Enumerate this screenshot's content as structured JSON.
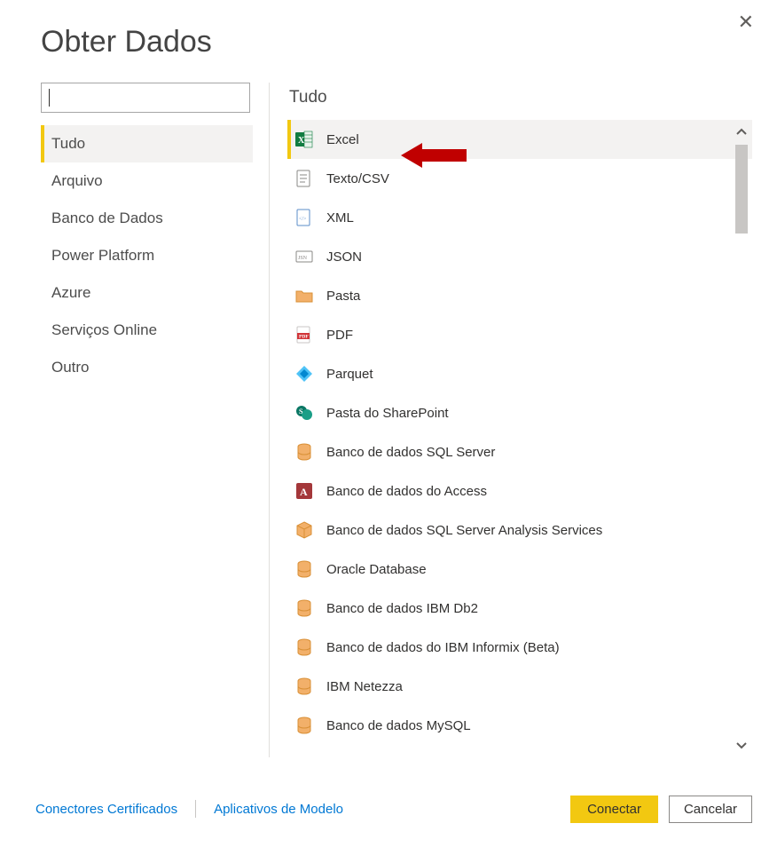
{
  "dialog": {
    "title": "Obter Dados",
    "close_icon": "✕"
  },
  "search": {
    "value": "",
    "placeholder": ""
  },
  "categories": [
    {
      "label": "Tudo",
      "selected": true
    },
    {
      "label": "Arquivo",
      "selected": false
    },
    {
      "label": "Banco de Dados",
      "selected": false
    },
    {
      "label": "Power Platform",
      "selected": false
    },
    {
      "label": "Azure",
      "selected": false
    },
    {
      "label": "Serviços Online",
      "selected": false
    },
    {
      "label": "Outro",
      "selected": false
    }
  ],
  "panel": {
    "header": "Tudo"
  },
  "connectors": [
    {
      "label": "Excel",
      "icon": "excel",
      "selected": true
    },
    {
      "label": "Texto/CSV",
      "icon": "text",
      "selected": false
    },
    {
      "label": "XML",
      "icon": "xml",
      "selected": false
    },
    {
      "label": "JSON",
      "icon": "json",
      "selected": false
    },
    {
      "label": "Pasta",
      "icon": "folder",
      "selected": false
    },
    {
      "label": "PDF",
      "icon": "pdf",
      "selected": false
    },
    {
      "label": "Parquet",
      "icon": "parquet",
      "selected": false
    },
    {
      "label": "Pasta do SharePoint",
      "icon": "sharepoint",
      "selected": false
    },
    {
      "label": "Banco de dados SQL Server",
      "icon": "db",
      "selected": false
    },
    {
      "label": "Banco de dados do Access",
      "icon": "access",
      "selected": false
    },
    {
      "label": "Banco de dados SQL Server Analysis Services",
      "icon": "cube",
      "selected": false
    },
    {
      "label": "Oracle Database",
      "icon": "db",
      "selected": false
    },
    {
      "label": "Banco de dados IBM Db2",
      "icon": "db",
      "selected": false
    },
    {
      "label": "Banco de dados do IBM Informix (Beta)",
      "icon": "db",
      "selected": false
    },
    {
      "label": "IBM Netezza",
      "icon": "db",
      "selected": false
    },
    {
      "label": "Banco de dados MySQL",
      "icon": "db",
      "selected": false
    }
  ],
  "footer": {
    "link_certified": "Conectores Certificados",
    "link_templates": "Aplicativos de Modelo",
    "connect": "Conectar",
    "cancel": "Cancelar"
  },
  "colors": {
    "accent": "#f2c811",
    "link": "#0078d4",
    "arrow": "#C00000"
  }
}
